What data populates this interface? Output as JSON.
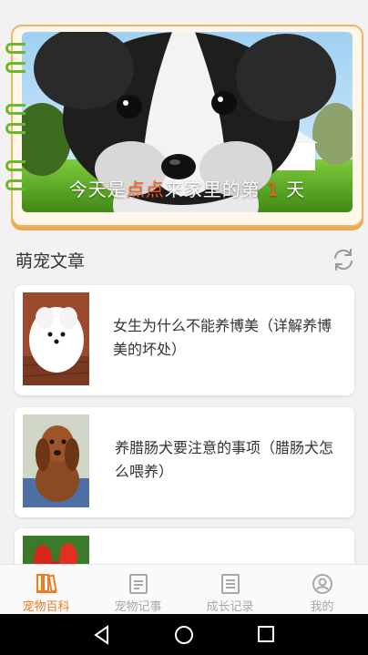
{
  "hero": {
    "caption_prefix": "今天是",
    "pet_name": "点点",
    "caption_middle": "来家里的第",
    "day_count": "1",
    "caption_suffix": "天"
  },
  "section": {
    "title": "萌宠文章"
  },
  "articles": [
    {
      "title": "女生为什么不能养博美（详解养博美的坏处）"
    },
    {
      "title": "养腊肠犬要注意的事项（腊肠犬怎么喂养）"
    },
    {
      "title": ""
    }
  ],
  "tabs": [
    {
      "label": "宠物百科",
      "icon": "book-icon",
      "active": true
    },
    {
      "label": "宠物记事",
      "icon": "note-icon",
      "active": false
    },
    {
      "label": "成长记录",
      "icon": "record-icon",
      "active": false
    },
    {
      "label": "我的",
      "icon": "user-icon",
      "active": false
    }
  ],
  "colors": {
    "accent": "#f07c1e",
    "highlight": "#ff5a1f",
    "ring": "#6ab82c",
    "card_border": "#f1b35e"
  }
}
